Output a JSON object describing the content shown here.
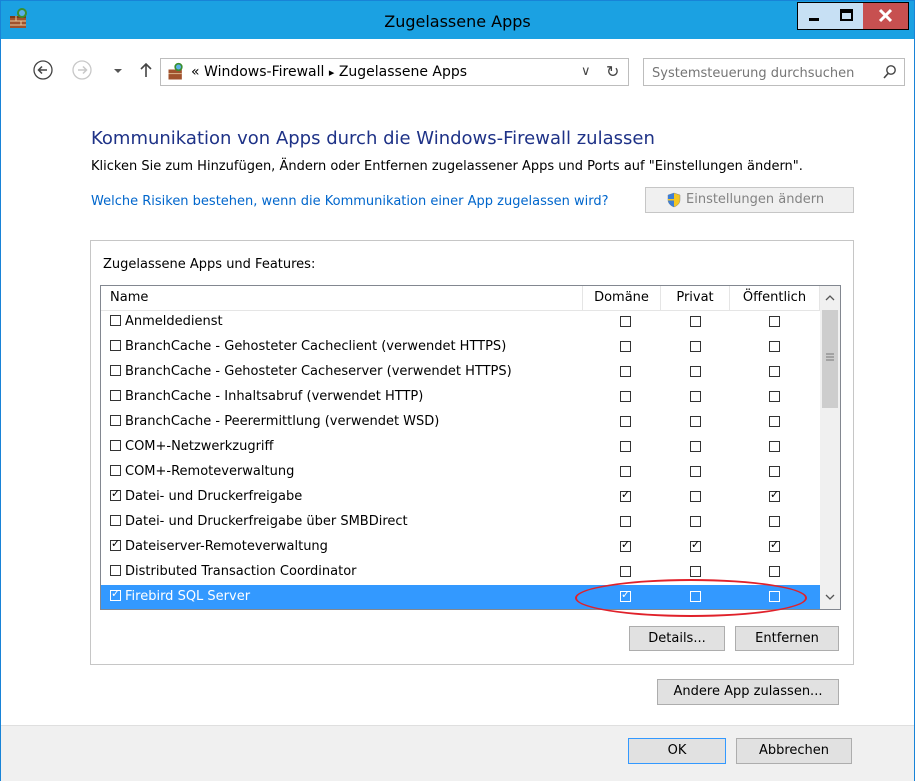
{
  "window": {
    "title": "Zugelassene Apps"
  },
  "address": {
    "prefix": "«",
    "crumb1": "Windows-Firewall",
    "separator": "▸",
    "crumb2": "Zugelassene Apps",
    "dropdown": "∨",
    "refresh": "↻"
  },
  "search": {
    "placeholder": "Systemsteuerung durchsuchen"
  },
  "content": {
    "heading": "Kommunikation von Apps durch die Windows-Firewall zulassen",
    "description": "Klicken Sie zum Hinzufügen, Ändern oder Entfernen zugelassener Apps und Ports auf \"Einstellungen ändern\".",
    "risk_link": "Welche Risiken bestehen, wenn die Kommunikation einer App zugelassen wird?",
    "change_settings": "Einstellungen ändern"
  },
  "group": {
    "label": "Zugelassene Apps und Features:",
    "columns": {
      "name": "Name",
      "domain": "Domäne",
      "private": "Privat",
      "public": "Öffentlich"
    },
    "rows": [
      {
        "name": "Anmeldedienst",
        "enabled": false,
        "domain": false,
        "private": false,
        "public": false
      },
      {
        "name": "BranchCache - Gehosteter Cacheclient (verwendet HTTPS)",
        "enabled": false,
        "domain": false,
        "private": false,
        "public": false
      },
      {
        "name": "BranchCache - Gehosteter Cacheserver (verwendet HTTPS)",
        "enabled": false,
        "domain": false,
        "private": false,
        "public": false
      },
      {
        "name": "BranchCache - Inhaltsabruf (verwendet HTTP)",
        "enabled": false,
        "domain": false,
        "private": false,
        "public": false
      },
      {
        "name": "BranchCache - Peerermittlung (verwendet WSD)",
        "enabled": false,
        "domain": false,
        "private": false,
        "public": false
      },
      {
        "name": "COM+-Netzwerkzugriff",
        "enabled": false,
        "domain": false,
        "private": false,
        "public": false
      },
      {
        "name": "COM+-Remoteverwaltung",
        "enabled": false,
        "domain": false,
        "private": false,
        "public": false
      },
      {
        "name": "Datei- und Druckerfreigabe",
        "enabled": true,
        "domain": true,
        "private": false,
        "public": true
      },
      {
        "name": "Datei- und Druckerfreigabe über SMBDirect",
        "enabled": false,
        "domain": false,
        "private": false,
        "public": false
      },
      {
        "name": "Dateiserver-Remoteverwaltung",
        "enabled": true,
        "domain": true,
        "private": true,
        "public": true
      },
      {
        "name": "Distributed Transaction Coordinator",
        "enabled": false,
        "domain": false,
        "private": false,
        "public": false
      },
      {
        "name": "Firebird SQL Server",
        "enabled": true,
        "domain": true,
        "private": false,
        "public": false,
        "selected": true
      }
    ],
    "details_button": "Details...",
    "remove_button": "Entfernen"
  },
  "allow_other_button": "Andere App zulassen...",
  "footer": {
    "ok": "OK",
    "cancel": "Abbrechen"
  },
  "colors": {
    "titlebar": "#1ba1e2",
    "heading": "#1e3287",
    "link": "#0066cc",
    "selection": "#3399ff",
    "highlight_circle": "#e0212a"
  }
}
